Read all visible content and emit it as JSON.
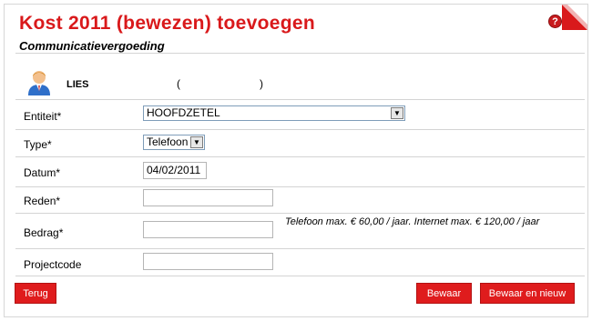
{
  "header": {
    "title": "Kost 2011 (bewezen) toevoegen",
    "subtitle": "Communicatievergoeding",
    "help_icon": "help-icon"
  },
  "user": {
    "avatar_icon": "user-avatar-icon",
    "name": "LIES",
    "open_paren": "(",
    "close_paren": ")"
  },
  "form": {
    "entiteit": {
      "label": "Entiteit*",
      "value": "HOOFDZETEL"
    },
    "type": {
      "label": "Type*",
      "value": "Telefoon"
    },
    "datum": {
      "label": "Datum*",
      "value": "04/02/2011"
    },
    "reden": {
      "label": "Reden*",
      "value": ""
    },
    "bedrag": {
      "label": "Bedrag*",
      "value": "",
      "hint": "Telefoon max. € 60,00 / jaar. Internet max. € 120,00 / jaar"
    },
    "projectcode": {
      "label": "Projectcode",
      "value": ""
    }
  },
  "buttons": {
    "back": "Terug",
    "save": "Bewaar",
    "save_new": "Bewaar en nieuw"
  },
  "colors": {
    "accent": "#d9191b",
    "button": "#df1c1d"
  }
}
